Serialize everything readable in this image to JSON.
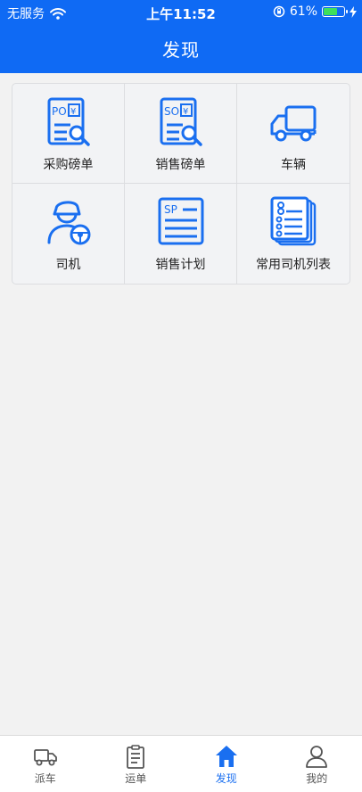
{
  "status_bar": {
    "carrier": "无服务",
    "time": "上午11:52",
    "battery": "61%",
    "battery_level": 0.61
  },
  "header": {
    "title": "发现"
  },
  "grid": {
    "items": [
      {
        "label": "采购磅单",
        "icon": "purchase-weigh-slip-icon",
        "icon_text": "PO"
      },
      {
        "label": "销售磅单",
        "icon": "sales-weigh-slip-icon",
        "icon_text": "SO"
      },
      {
        "label": "车辆",
        "icon": "truck-icon"
      },
      {
        "label": "司机",
        "icon": "driver-icon"
      },
      {
        "label": "销售计划",
        "icon": "sales-plan-icon",
        "icon_text": "SP"
      },
      {
        "label": "常用司机列表",
        "icon": "driver-list-icon"
      }
    ]
  },
  "tabbar": {
    "items": [
      {
        "label": "派车",
        "icon": "truck-icon",
        "active": false
      },
      {
        "label": "运单",
        "icon": "clipboard-icon",
        "active": false
      },
      {
        "label": "发现",
        "icon": "home-icon",
        "active": true
      },
      {
        "label": "我的",
        "icon": "user-icon",
        "active": false
      }
    ]
  },
  "colors": {
    "primary": "#0f6af4",
    "icon_blue": "#1a6ff0",
    "battery_green": "#3ee05c"
  }
}
